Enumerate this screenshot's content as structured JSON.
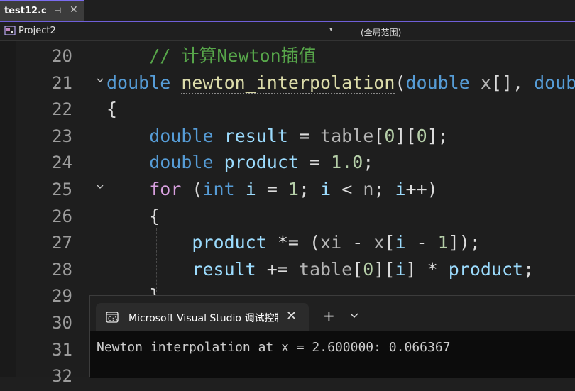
{
  "tab": {
    "file_name": "test12.c",
    "pin_glyph": "⊣",
    "close_glyph": "✕"
  },
  "nav": {
    "project": "Project2",
    "scope": "(全局范围)",
    "dropdown_glyph": "▾"
  },
  "lines": [
    {
      "n": "20",
      "fold": false,
      "tokens": [
        [
          "",
          "    "
        ],
        [
          "cm",
          "// 计算Newton插值"
        ]
      ]
    },
    {
      "n": "21",
      "fold": true,
      "tokens": [
        [
          "kw",
          "double"
        ],
        [
          "",
          " "
        ],
        [
          "fn fnu",
          "newton_interpolation"
        ],
        [
          "",
          "("
        ],
        [
          "kw",
          "double"
        ],
        [
          "",
          " "
        ],
        [
          "gray",
          "x"
        ],
        [
          "",
          "[], "
        ],
        [
          "kw",
          "double"
        ]
      ]
    },
    {
      "n": "22",
      "fold": false,
      "tokens": [
        [
          "",
          "{"
        ]
      ]
    },
    {
      "n": "23",
      "fold": false,
      "tokens": [
        [
          "",
          "    "
        ],
        [
          "kw",
          "double"
        ],
        [
          "",
          " "
        ],
        [
          "var",
          "result"
        ],
        [
          "",
          " = "
        ],
        [
          "gray",
          "table"
        ],
        [
          "",
          "["
        ],
        [
          "num",
          "0"
        ],
        [
          "",
          "]["
        ],
        [
          "num",
          "0"
        ],
        [
          "",
          "];"
        ]
      ]
    },
    {
      "n": "24",
      "fold": false,
      "tokens": [
        [
          "",
          "    "
        ],
        [
          "kw",
          "double"
        ],
        [
          "",
          " "
        ],
        [
          "var",
          "product"
        ],
        [
          "",
          " = "
        ],
        [
          "num",
          "1.0"
        ],
        [
          "",
          ";"
        ]
      ]
    },
    {
      "n": "25",
      "fold": true,
      "tokens": [
        [
          "",
          "    "
        ],
        [
          "ctl",
          "for"
        ],
        [
          "",
          " ("
        ],
        [
          "kw",
          "int"
        ],
        [
          "",
          " "
        ],
        [
          "var",
          "i"
        ],
        [
          "",
          " = "
        ],
        [
          "num",
          "1"
        ],
        [
          "",
          "; "
        ],
        [
          "var",
          "i"
        ],
        [
          "",
          " < "
        ],
        [
          "gray",
          "n"
        ],
        [
          "",
          "; "
        ],
        [
          "var",
          "i"
        ],
        [
          "",
          "++)"
        ]
      ]
    },
    {
      "n": "26",
      "fold": false,
      "tokens": [
        [
          "",
          "    {"
        ]
      ]
    },
    {
      "n": "27",
      "fold": false,
      "tokens": [
        [
          "",
          "        "
        ],
        [
          "var",
          "product"
        ],
        [
          "",
          " *= ("
        ],
        [
          "gray",
          "xi"
        ],
        [
          "",
          " - "
        ],
        [
          "gray",
          "x"
        ],
        [
          "",
          "["
        ],
        [
          "var",
          "i"
        ],
        [
          "",
          " - "
        ],
        [
          "num",
          "1"
        ],
        [
          "",
          "]);"
        ]
      ]
    },
    {
      "n": "28",
      "fold": false,
      "tokens": [
        [
          "",
          "        "
        ],
        [
          "var",
          "result"
        ],
        [
          "",
          " += "
        ],
        [
          "gray",
          "table"
        ],
        [
          "",
          "["
        ],
        [
          "num",
          "0"
        ],
        [
          "",
          "]["
        ],
        [
          "var",
          "i"
        ],
        [
          "",
          "] * "
        ],
        [
          "var",
          "product"
        ],
        [
          "",
          ";"
        ]
      ]
    },
    {
      "n": "29",
      "fold": false,
      "tokens": [
        [
          "",
          "    }"
        ]
      ]
    },
    {
      "n": "30",
      "fold": false,
      "tokens": []
    },
    {
      "n": "31",
      "fold": false,
      "tokens": [
        [
          "",
          "}"
        ]
      ]
    },
    {
      "n": "32",
      "fold": false,
      "tokens": []
    }
  ],
  "console": {
    "tab_title": "Microsoft Visual Studio 调试控制台",
    "close_glyph": "✕",
    "plus_glyph": "+",
    "dropdown_glyph": "⌄",
    "output": "Newton interpolation at x = 2.600000: 0.066367"
  }
}
